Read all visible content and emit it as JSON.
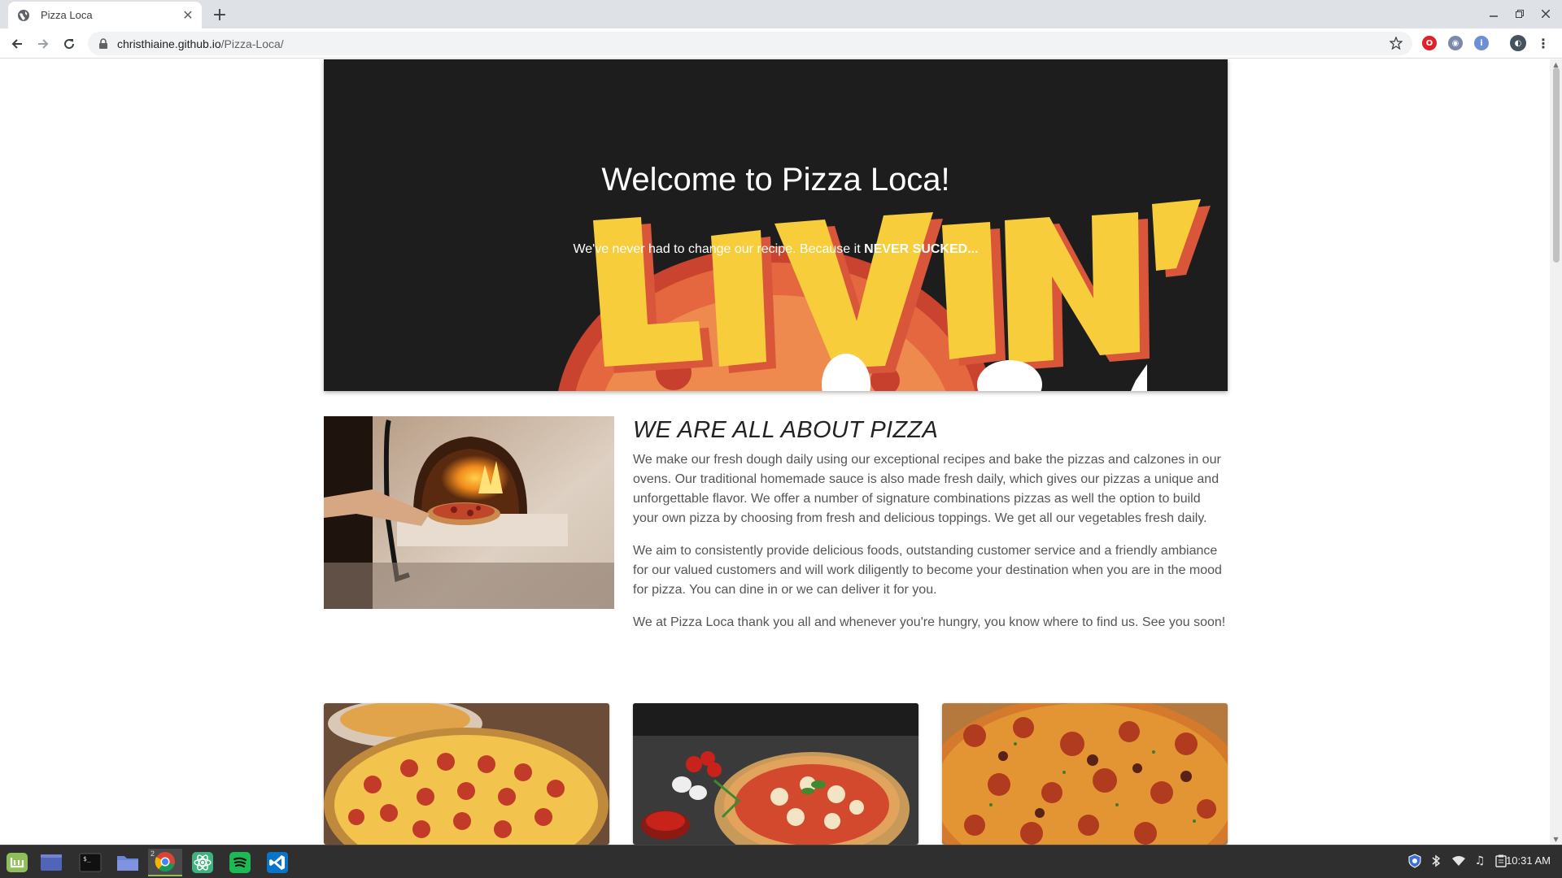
{
  "browser": {
    "tab_title": "Pizza Loca",
    "url_host": "christhiaine.github.io",
    "url_path": "/Pizza-Loca/"
  },
  "page": {
    "hero": {
      "title": "Welcome to Pizza Loca!",
      "subtitle_prefix": "We've never had to change our recipe. Because it ",
      "subtitle_emphasis": "NEVER SUCKED...",
      "art_text": "LIVIN'"
    },
    "about": {
      "heading": "WE ARE ALL ABOUT PIZZA",
      "paragraphs": [
        "We make our fresh dough daily using our exceptional recipes and bake the pizzas and calzones in our ovens. Our traditional homemade sauce is also made fresh daily, which gives our pizzas a unique and unforgettable flavor. We offer a number of signature combinations pizzas as well the option to build your own pizza by choosing from fresh and delicious toppings. We get all our vegetables fresh daily.",
        "We aim to consistently provide delicious foods, outstanding customer service and a friendly ambiance for our valued customers and will work diligently to become your destination when you are in the mood for pizza. You can dine in or we can deliver it for you.",
        "We at Pizza Loca thank you all and whenever you're hungry, you know where to find us. See you soon!"
      ]
    }
  },
  "taskbar": {
    "clock": "10:31 AM",
    "chrome_badge": "2"
  },
  "colors": {
    "hero_bg": "#1d1d1d",
    "livin_yellow": "#f7cd3c",
    "livin_shadow": "#d9563a",
    "taskbar_bg": "#2f2f2f"
  }
}
